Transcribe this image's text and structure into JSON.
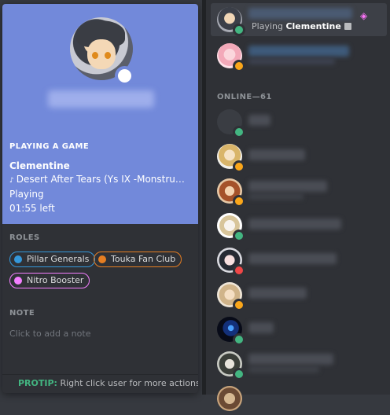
{
  "profile": {
    "playing_header": "PLAYING A GAME",
    "game_name": "Clementine",
    "game_details": "Desert After Tears (Ys IX -Monstrum Nox- OST)",
    "game_state": "Playing",
    "time_left": "01:55 left",
    "note_glyph": "♪",
    "roles_header": "ROLES",
    "roles": [
      {
        "label": "Pillar Generals",
        "color": "#3498db"
      },
      {
        "label": "Touka Fan Club",
        "color": "#e67e22"
      },
      {
        "label": "Nitro Booster",
        "color": "#f47fff"
      }
    ],
    "note_header": "NOTE",
    "note_placeholder": "Click to add a note",
    "protip_label": "PROTIP:",
    "protip_text": " Right click user for more actions"
  },
  "members": {
    "top": [
      {
        "status": "online",
        "activity_prefix": "Playing ",
        "activity_game": "Clementine",
        "nitro_glyph": "◈"
      },
      {
        "status": "idle"
      }
    ],
    "group_header": "ONLINE—61",
    "list": [
      {
        "status": "online"
      },
      {
        "status": "idle"
      },
      {
        "status": "idle"
      },
      {
        "status": "online"
      },
      {
        "status": "dnd"
      },
      {
        "status": "idle"
      },
      {
        "status": "online"
      },
      {
        "status": "online"
      }
    ]
  }
}
